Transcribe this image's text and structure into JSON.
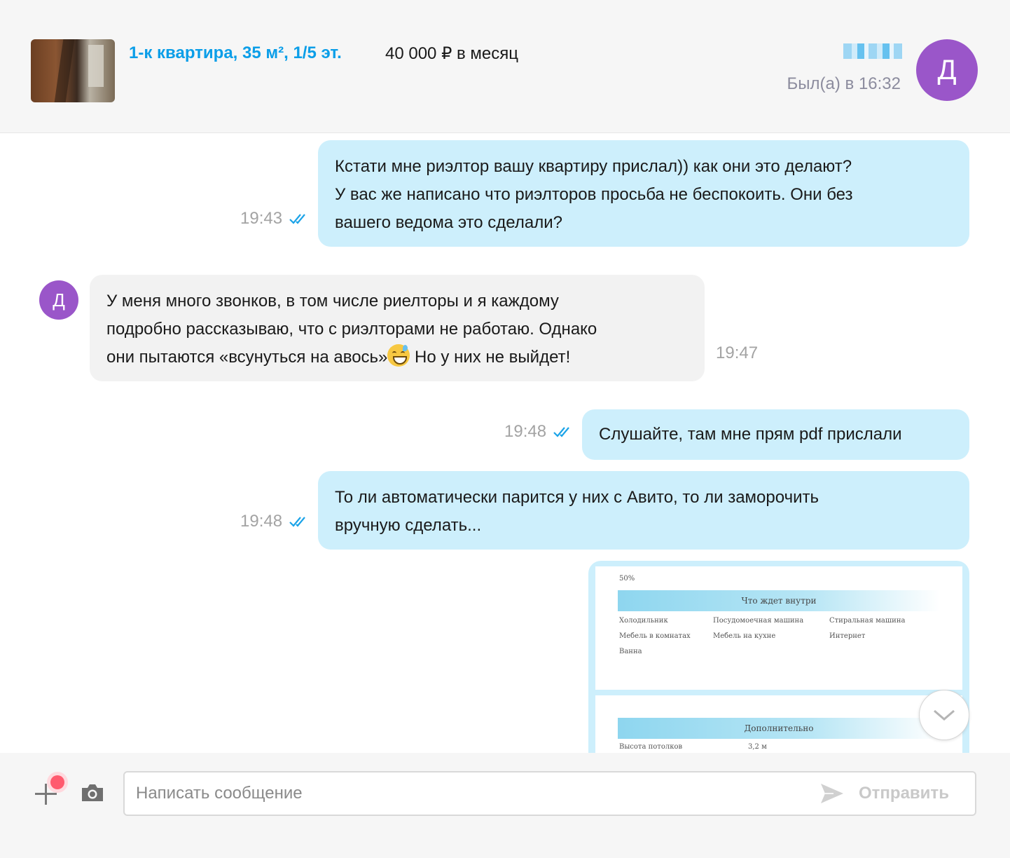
{
  "header": {
    "listing_title": "1-к квартира, 35 м², 1/5 эт.",
    "listing_price": "40 000 ₽ в месяц",
    "last_seen": "Был(а) в 16:32",
    "avatar_letter": "Д"
  },
  "messages": [
    {
      "direction": "outgoing",
      "lines": [
        "Кстати мне риэлтор вашу квартиру прислал)) как они это делают?",
        "У вас же написано что риэлторов просьба не беспокоить. Они без",
        "вашего ведома это сделали?"
      ],
      "time": "19:43",
      "read": true
    },
    {
      "direction": "incoming",
      "sender_avatar_letter": "Д",
      "lines": [
        "У меня много звонков, в том числе риелторы и я каждому",
        "подробно рассказываю, что с риэлторами не работаю. Однако",
        "они пытаются «всунуться на авось»",
        " Но у них не выйдет!"
      ],
      "emoji_icon": "grinning-sweat-emoji",
      "time": "19:47"
    },
    {
      "direction": "outgoing",
      "lines": [
        "Слушайте, там мне прям pdf прислали"
      ],
      "time": "19:48",
      "read": true
    },
    {
      "direction": "outgoing",
      "lines": [
        "То ли автоматически парится у них с Авито, то ли заморочить",
        "вручную сделать..."
      ],
      "time": "19:48",
      "read": true
    }
  ],
  "attachment": {
    "page1": {
      "top_text": "50%",
      "band_title": "Что ждет внутри",
      "amenities": [
        [
          "Холодильник",
          "Посудомоечная машина",
          "Стиральная машина"
        ],
        [
          "Мебель в комнатах",
          "Мебель на кухне",
          "Интернет"
        ],
        [
          "Ванна",
          "",
          ""
        ]
      ]
    },
    "page2": {
      "band_title": "Дополнительно",
      "row_label": "Высота потолков",
      "row_value": "3,2 м"
    }
  },
  "composer": {
    "placeholder": "Написать сообщение",
    "send_label": "Отправить"
  },
  "colors": {
    "accent": "#0b9ee8",
    "avatar": "#9a56c9",
    "outgoing_bubble": "#cdeffc",
    "incoming_bubble": "#f2f2f2",
    "read_checks": "#1aa3e8",
    "notification_dot": "#ff5a6e"
  },
  "icons": [
    "double-check-icon",
    "chevron-down-icon",
    "plus-icon",
    "camera-icon",
    "send-icon"
  ]
}
